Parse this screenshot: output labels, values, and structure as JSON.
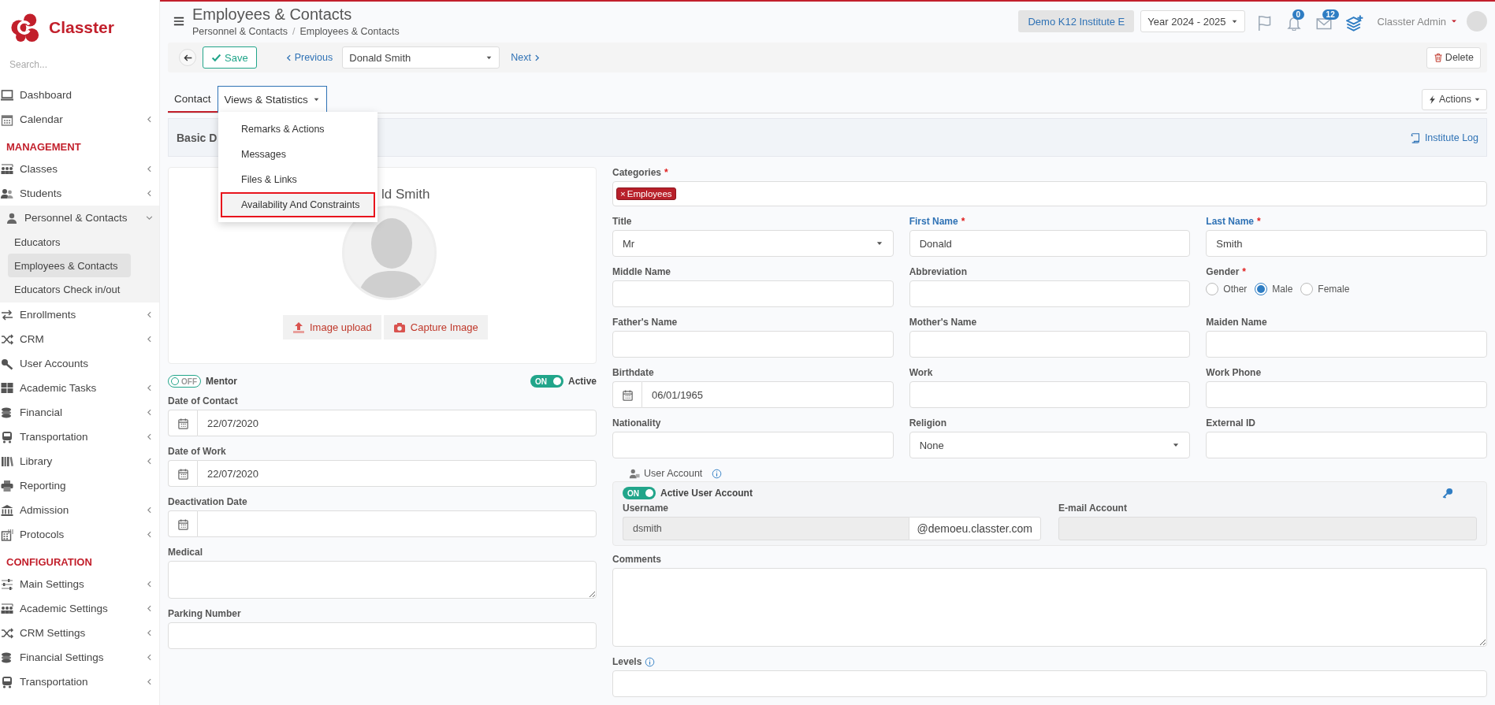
{
  "sidebar": {
    "brand": "Classter",
    "search": {
      "placeholder": "Search..."
    },
    "sections": [
      {
        "items": [
          {
            "label": "Dashboard",
            "kind": "link"
          },
          {
            "label": "Calendar",
            "kind": "menu",
            "expanded": false
          }
        ]
      },
      {
        "heading": "MANAGEMENT",
        "items": [
          {
            "label": "Classes",
            "kind": "menu",
            "expanded": false
          },
          {
            "label": "Students",
            "kind": "menu",
            "expanded": false
          },
          {
            "label": "Personnel & Contacts",
            "kind": "menu",
            "expanded": true,
            "children": [
              {
                "label": "Educators",
                "selected": false
              },
              {
                "label": "Employees & Contacts",
                "selected": true
              },
              {
                "label": "Educators Check in/out",
                "selected": false
              }
            ]
          },
          {
            "label": "Enrollments",
            "kind": "menu",
            "expanded": false
          },
          {
            "label": "CRM",
            "kind": "menu",
            "expanded": false
          },
          {
            "label": "User Accounts",
            "kind": "link"
          },
          {
            "label": "Academic Tasks",
            "kind": "menu",
            "expanded": false
          },
          {
            "label": "Financial",
            "kind": "menu",
            "expanded": false
          },
          {
            "label": "Transportation",
            "kind": "menu",
            "expanded": false
          },
          {
            "label": "Library",
            "kind": "menu",
            "expanded": false
          },
          {
            "label": "Reporting",
            "kind": "link"
          },
          {
            "label": "Admission",
            "kind": "menu",
            "expanded": false
          },
          {
            "label": "Protocols",
            "kind": "menu",
            "expanded": false
          }
        ]
      },
      {
        "heading": "CONFIGURATION",
        "items": [
          {
            "label": "Main Settings",
            "kind": "menu",
            "expanded": false
          },
          {
            "label": "Academic Settings",
            "kind": "menu",
            "expanded": false
          },
          {
            "label": "CRM Settings",
            "kind": "menu",
            "expanded": false
          },
          {
            "label": "Financial Settings",
            "kind": "menu",
            "expanded": false
          },
          {
            "label": "Transportation",
            "kind": "menu",
            "expanded": false
          }
        ]
      }
    ]
  },
  "header": {
    "title": "Employees & Contacts",
    "breadcrumb": [
      "Personnel & Contacts",
      "Employees & Contacts"
    ],
    "breadcrumb_separator": "/",
    "institute": "Demo K12 Institute E",
    "year": "Year 2024 - 2025",
    "notifications": "0",
    "messages": "12",
    "user": "Classter Admin"
  },
  "toolbar": {
    "save": "Save",
    "previous": "Previous",
    "record": "Donald Smith",
    "next": "Next",
    "delete": "Delete"
  },
  "tabs": [
    {
      "label": "Contact",
      "kind": "tab",
      "selected": true
    },
    {
      "label": "Views & Statistics",
      "kind": "dropdown",
      "selected": false,
      "expanded": true
    }
  ],
  "views_menu": [
    {
      "label": "Remarks & Actions",
      "selected": false
    },
    {
      "label": "Messages",
      "selected": false
    },
    {
      "label": "Files & Links",
      "selected": false
    },
    {
      "label": "Availability And Constraints",
      "selected": true
    }
  ],
  "actions": "Actions",
  "panel": {
    "title": "Basic D",
    "log": "Institute Log"
  },
  "profile": {
    "name": "ld Smith",
    "upload": "Image upload",
    "capture": "Capture Image"
  },
  "toggles": [
    {
      "label": "Mentor",
      "on": false,
      "text": "OFF"
    },
    {
      "label": "Active",
      "on": true,
      "text": "ON"
    }
  ],
  "left_fields": [
    {
      "label": "Date of Contact",
      "kind": "date",
      "value": "22/07/2020"
    },
    {
      "label": "Date of Work",
      "kind": "date",
      "value": "22/07/2020"
    },
    {
      "label": "Deactivation Date",
      "kind": "date"
    },
    {
      "label": "Medical",
      "kind": "textarea"
    },
    {
      "label": "Parking Number",
      "kind": "text"
    }
  ],
  "categories": {
    "label": "Categories",
    "mark": "*",
    "tags": [
      {
        "remove": "×",
        "label": "Employees"
      }
    ]
  },
  "grid_fields": [
    {
      "label": "Title",
      "kind": "select",
      "value": "Mr",
      "highlighted": false
    },
    {
      "label": "First Name",
      "mark": "*",
      "kind": "text",
      "value": "Donald",
      "highlighted": true
    },
    {
      "label": "Last Name",
      "mark": "*",
      "kind": "text",
      "value": "Smith",
      "highlighted": true
    },
    {
      "label": "Middle Name",
      "kind": "text",
      "highlighted": false
    },
    {
      "label": "Abbreviation",
      "kind": "text",
      "highlighted": false
    },
    {
      "label": "Gender",
      "mark": "*",
      "kind": "radio",
      "highlighted": false,
      "options": [
        {
          "label": "Other",
          "selected": false
        },
        {
          "label": "Male",
          "selected": true
        },
        {
          "label": "Female",
          "selected": false
        }
      ]
    },
    {
      "label": "Father's Name",
      "kind": "text",
      "highlighted": false
    },
    {
      "label": "Mother's Name",
      "kind": "text",
      "highlighted": false
    },
    {
      "label": "Maiden Name",
      "kind": "text",
      "highlighted": false
    },
    {
      "label": "Birthdate",
      "kind": "date",
      "value": "06/01/1965",
      "highlighted": false
    },
    {
      "label": "Work",
      "kind": "text",
      "highlighted": false
    },
    {
      "label": "Work Phone",
      "kind": "text",
      "highlighted": false
    },
    {
      "label": "Nationality",
      "kind": "text",
      "highlighted": false
    },
    {
      "label": "Religion",
      "kind": "select",
      "value": "None",
      "highlighted": false
    },
    {
      "label": "External ID",
      "kind": "text",
      "highlighted": false
    }
  ],
  "user_account": {
    "legend": "User Account",
    "toggle": {
      "label": "Active User Account",
      "on": true,
      "text": "ON"
    },
    "username_label": "Username",
    "username": "dsmith",
    "domain": "@demoeu.classter.com",
    "email_label": "E-mail Account"
  },
  "comments": {
    "label": "Comments"
  },
  "levels": {
    "label": "Levels"
  }
}
